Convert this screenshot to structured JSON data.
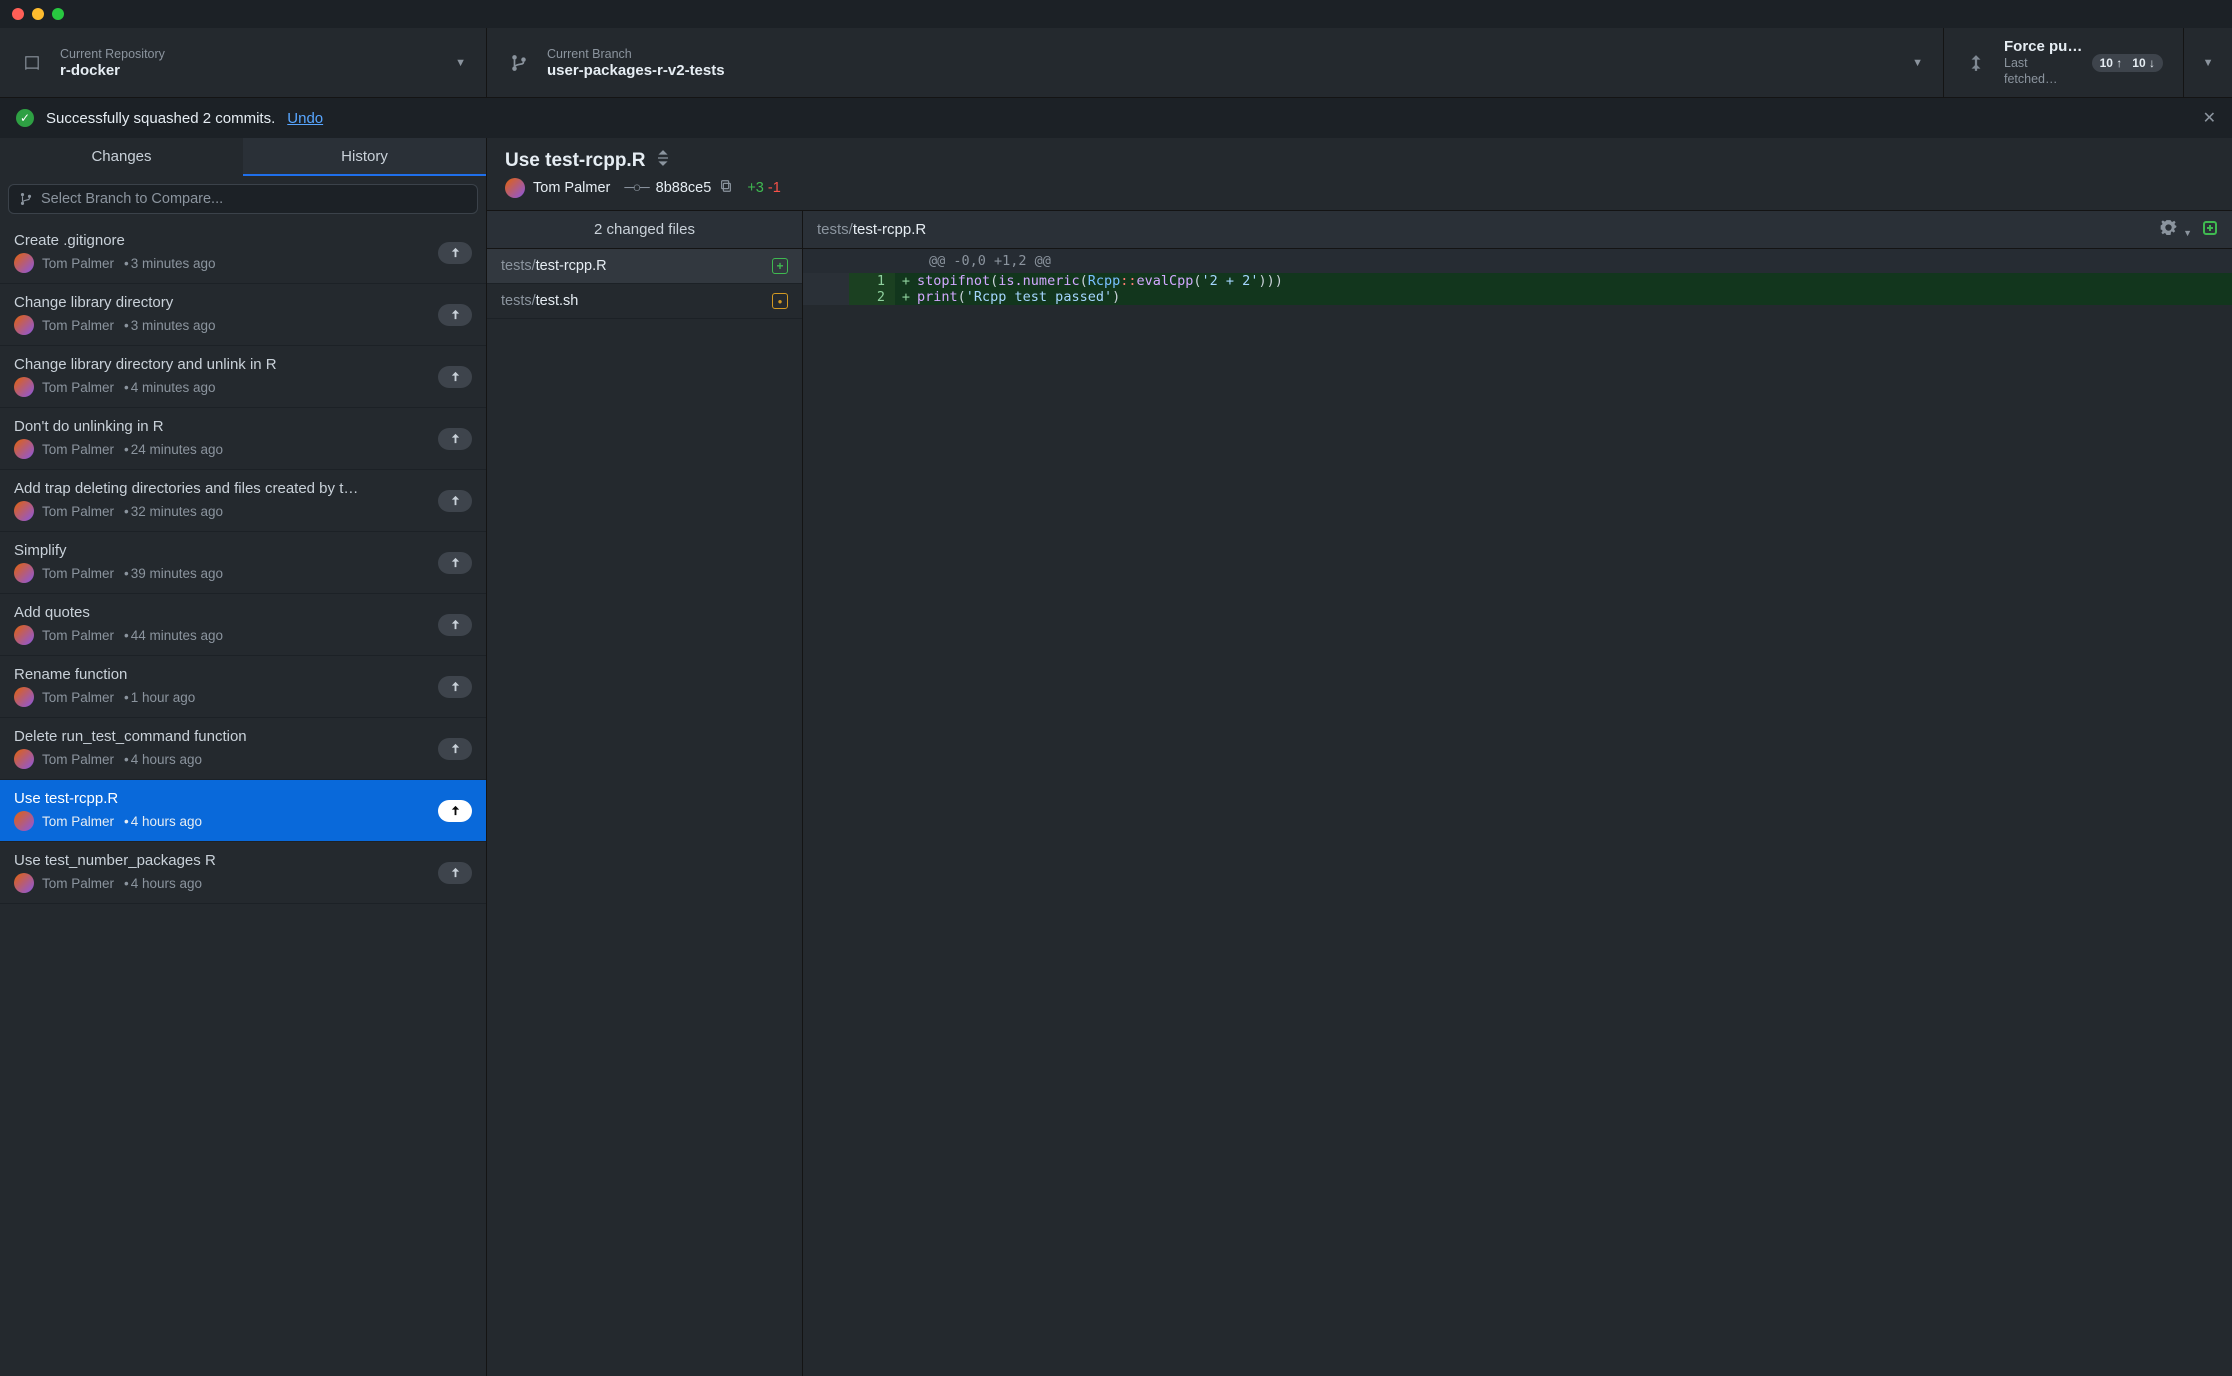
{
  "toolbar": {
    "repo_label": "Current Repository",
    "repo_value": "r-docker",
    "branch_label": "Current Branch",
    "branch_value": "user-packages-r-v2-tests",
    "push_title": "Force pus…",
    "push_sub": "Last fetched…",
    "ahead": "10",
    "behind": "10"
  },
  "banner": {
    "text": "Successfully squashed 2 commits.",
    "undo": "Undo"
  },
  "tabs": {
    "changes": "Changes",
    "history": "History"
  },
  "filter_placeholder": "Select Branch to Compare...",
  "commits": [
    {
      "title": "Create .gitignore",
      "author": "Tom Palmer",
      "time": "3 minutes ago"
    },
    {
      "title": "Change library directory",
      "author": "Tom Palmer",
      "time": "3 minutes ago"
    },
    {
      "title": "Change library directory and unlink in R",
      "author": "Tom Palmer",
      "time": "4 minutes ago"
    },
    {
      "title": "Don't do unlinking in R",
      "author": "Tom Palmer",
      "time": "24 minutes ago"
    },
    {
      "title": "Add trap deleting directories and files created by t…",
      "author": "Tom Palmer",
      "time": "32 minutes ago"
    },
    {
      "title": "Simplify",
      "author": "Tom Palmer",
      "time": "39 minutes ago"
    },
    {
      "title": "Add quotes",
      "author": "Tom Palmer",
      "time": "44 minutes ago"
    },
    {
      "title": "Rename function",
      "author": "Tom Palmer",
      "time": "1 hour ago"
    },
    {
      "title": "Delete run_test_command function",
      "author": "Tom Palmer",
      "time": "4 hours ago"
    },
    {
      "title": "Use test-rcpp.R",
      "author": "Tom Palmer",
      "time": "4 hours ago"
    },
    {
      "title": "Use test_number_packages R",
      "author": "Tom Palmer",
      "time": "4 hours ago"
    }
  ],
  "selected_commit_index": 9,
  "detail": {
    "title": "Use test-rcpp.R",
    "author": "Tom Palmer",
    "sha": "8b88ce5",
    "additions": "+3",
    "deletions": "-1",
    "files_header": "2 changed files",
    "files": [
      {
        "dir": "tests/",
        "name": "test-rcpp.R",
        "status": "added"
      },
      {
        "dir": "tests/",
        "name": "test.sh",
        "status": "modified"
      }
    ],
    "selected_file_index": 0,
    "open_file": {
      "dir": "tests/",
      "name": "test-rcpp.R"
    },
    "hunk": "@@ -0,0 +1,2 @@",
    "lines": [
      {
        "n": "1",
        "code_html": "<span class='tok-fn'>stopifnot</span><span class='tok-paren'>(</span><span class='tok-fn'>is.numeric</span><span class='tok-paren'>(</span><span class='tok-id'>Rcpp</span><span class='tok-op'>::</span><span class='tok-fn'>evalCpp</span><span class='tok-paren'>(</span><span class='tok-str'>'2 + 2'</span><span class='tok-paren'>)))</span>"
      },
      {
        "n": "2",
        "code_html": "<span class='tok-fn'>print</span><span class='tok-paren'>(</span><span class='tok-str'>'Rcpp test passed'</span><span class='tok-paren'>)</span>"
      }
    ]
  }
}
